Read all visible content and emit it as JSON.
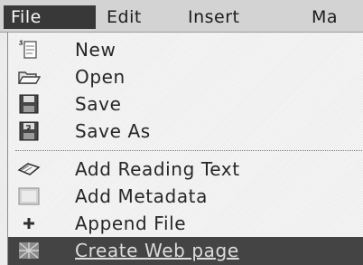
{
  "menubar": {
    "items": [
      {
        "label": "File",
        "active": true
      },
      {
        "label": "Edit"
      },
      {
        "label": "Insert"
      },
      {
        "label": "Ma"
      }
    ]
  },
  "file_menu": {
    "items": [
      {
        "label": "New",
        "icon": "new-document-icon"
      },
      {
        "label": "Open",
        "icon": "open-folder-icon"
      },
      {
        "label": "Save",
        "icon": "floppy-disk-icon"
      },
      {
        "label": "Save As",
        "icon": "floppy-disk-save-as-icon"
      },
      {
        "label": "Add Reading Text",
        "icon": "open-book-icon"
      },
      {
        "label": "Add Metadata",
        "icon": "metadata-icon"
      },
      {
        "label": "Append File",
        "icon": "plus-icon"
      },
      {
        "label": "Create Web page",
        "icon": "web-page-icon",
        "highlighted": true
      }
    ]
  }
}
